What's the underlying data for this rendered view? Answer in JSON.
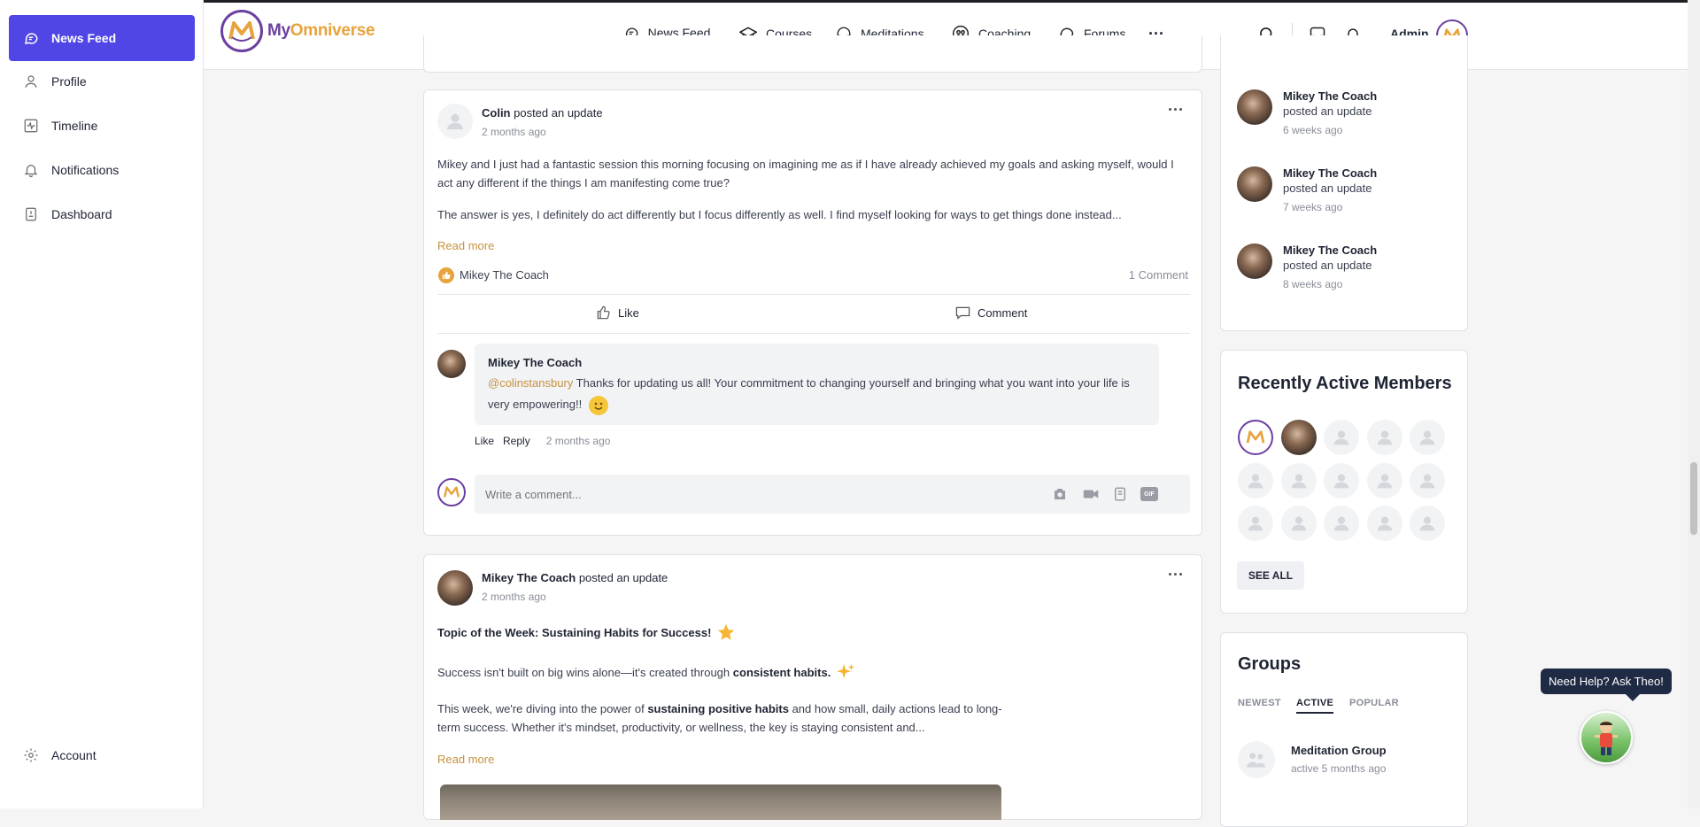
{
  "sidebar": {
    "items": [
      {
        "label": "News Feed",
        "icon": "chat-bubble-icon"
      },
      {
        "label": "Profile",
        "icon": "user-icon"
      },
      {
        "label": "Timeline",
        "icon": "activity-icon"
      },
      {
        "label": "Notifications",
        "icon": "bell-icon"
      },
      {
        "label": "Dashboard",
        "icon": "dashboard-icon"
      }
    ],
    "account": "Account"
  },
  "header": {
    "brand_part1": "My",
    "brand_part2": "Omniverse",
    "nav": [
      "News Feed",
      "Courses",
      "Meditations",
      "Coaching",
      "Forums"
    ],
    "user_name": "Admin"
  },
  "post1": {
    "author": "Colin",
    "action": " posted an update",
    "time": "2 months ago",
    "paragraph1": "Mikey and I just had a fantastic session this morning focusing on imagining me as if I have already achieved my goals and asking myself, would I act any different if the things I am manifesting come true?",
    "paragraph2": "The answer is yes, I definitely do act differently but I focus differently as well. I find myself looking for ways to get things done instead...",
    "read_more": "Read more",
    "reaction_by": "Mikey The Coach",
    "comment_count": "1 Comment",
    "like_label": "Like",
    "comment_label": "Comment",
    "comment": {
      "author": "Mikey The Coach",
      "mention": "@colinstansbury",
      "text": " Thanks for updating us all! Your commitment to changing yourself and bringing what you want into your life is very empowering!!",
      "like": "Like",
      "reply": "Reply",
      "time": "2 months ago"
    },
    "comment_placeholder": "Write a comment..."
  },
  "post2": {
    "author": "Mikey The Coach",
    "action": " posted an update",
    "time": "2 months ago",
    "heading": "Topic of the Week: Sustaining Habits for Success!",
    "line1_a": "Success isn't built on big wins alone—it's created through ",
    "line1_b": "consistent habits.",
    "line2_a": "This week, we're diving into the power of ",
    "line2_b": "sustaining positive habits",
    "line2_c": " and how small, daily actions lead to long-term success. Whether it's mindset, productivity, or wellness, the key is staying consistent and...",
    "read_more": "Read more"
  },
  "activity": [
    {
      "name": "Mikey The Coach",
      "action": "posted an update",
      "time": "6 weeks ago"
    },
    {
      "name": "Mikey The Coach",
      "action": "posted an update",
      "time": "7 weeks ago"
    },
    {
      "name": "Mikey The Coach",
      "action": "posted an update",
      "time": "8 weeks ago"
    }
  ],
  "members": {
    "title": "Recently Active Members",
    "see_all": "SEE ALL"
  },
  "groups": {
    "title": "Groups",
    "tabs": [
      "NEWEST",
      "ACTIVE",
      "POPULAR"
    ],
    "item_name": "Meditation Group",
    "item_meta": "active 5 months ago"
  },
  "help": {
    "label": "Need Help? Ask Theo!"
  },
  "colors": {
    "accent": "#4f46e5",
    "brand_purple": "#6b3fa0",
    "brand_gold": "#e8a33d",
    "link": "#c7923e"
  }
}
